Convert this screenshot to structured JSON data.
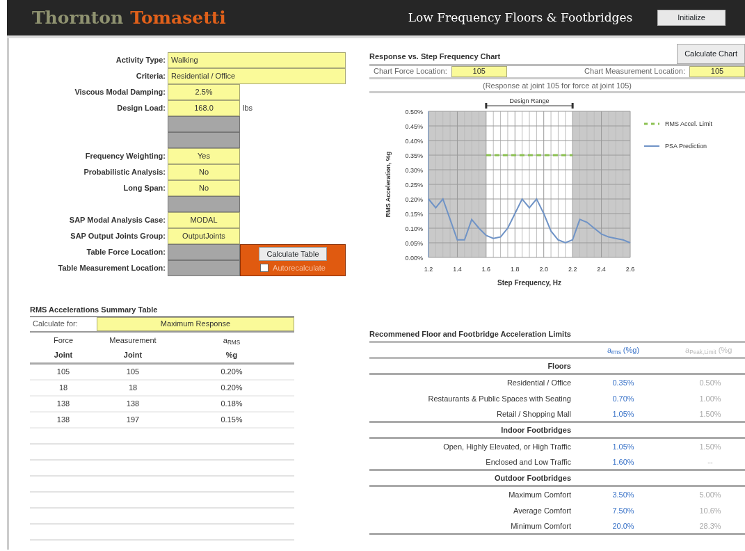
{
  "header": {
    "logo_first": "Thornton",
    "logo_second": "Tomasetti",
    "title": "Low Frequency Floors & Footbridges",
    "button": "Initialize"
  },
  "form": {
    "rows": [
      {
        "label": "Activity Type:",
        "value": "Walking",
        "kind": "wide"
      },
      {
        "label": "Criteria:",
        "value": "Residential / Office",
        "kind": "wide"
      },
      {
        "label": "Viscous Modal Damping:",
        "value": "2.5%",
        "kind": "input"
      },
      {
        "label": "Design Load:",
        "value": "168.0",
        "kind": "input",
        "unit": "lbs"
      },
      {
        "kind": "disabled"
      },
      {
        "kind": "disabled"
      },
      {
        "label": "Frequency Weighting:",
        "value": "Yes",
        "kind": "input"
      },
      {
        "label": "Probabilistic Analysis:",
        "value": "No",
        "kind": "input"
      },
      {
        "label": "Long Span:",
        "value": "No",
        "kind": "input"
      },
      {
        "kind": "disabled"
      },
      {
        "label": "SAP Modal Analysis Case:",
        "value": "MODAL",
        "kind": "input"
      },
      {
        "label": "SAP Output Joints Group:",
        "value": "OutputJoints",
        "kind": "input"
      },
      {
        "label": "Table Force Location:",
        "kind": "disabled"
      },
      {
        "label": "Table Measurement Location:",
        "kind": "disabled"
      }
    ],
    "action_panel": {
      "button": "Calculate Table",
      "checkbox": {
        "label": "Autorecalculate",
        "checked": false
      }
    }
  },
  "chart_panel": {
    "title": "Response vs. Step Frequency Chart",
    "button": "Calculate Chart",
    "force_label": "Chart Force Location:",
    "force_value": "105",
    "measurement_label": "Chart Measurement Location:",
    "measurement_value": "105",
    "subtitle": "(Response at joint 105 for force at joint 105)",
    "chart_data": {
      "type": "line",
      "xlabel": "Step Frequency, Hz",
      "ylabel": "RMS Acceleration, %g",
      "x": [
        1.2,
        1.25,
        1.3,
        1.35,
        1.4,
        1.45,
        1.5,
        1.55,
        1.6,
        1.65,
        1.7,
        1.75,
        1.8,
        1.85,
        1.9,
        1.95,
        2.0,
        2.05,
        2.1,
        2.15,
        2.2,
        2.25,
        2.3,
        2.35,
        2.4,
        2.45,
        2.5,
        2.55,
        2.6
      ],
      "series": [
        {
          "name": "RMS Accel. Limit",
          "color": "#8cc152",
          "line_style": "dashed",
          "values": [
            null,
            null,
            null,
            null,
            null,
            null,
            null,
            null,
            0.35,
            0.35,
            0.35,
            0.35,
            0.35,
            0.35,
            0.35,
            0.35,
            0.35,
            0.35,
            0.35,
            0.35,
            0.35,
            null,
            null,
            null,
            null,
            null,
            null,
            null,
            null
          ]
        },
        {
          "name": "PSA Prediction",
          "color": "#6f93c6",
          "line_style": "solid",
          "values": [
            0.2,
            0.17,
            0.2,
            0.13,
            0.06,
            0.06,
            0.13,
            0.1,
            0.075,
            0.065,
            0.07,
            0.1,
            0.15,
            0.2,
            0.17,
            0.2,
            0.15,
            0.09,
            0.06,
            0.05,
            0.06,
            0.13,
            0.12,
            0.1,
            0.08,
            0.07,
            0.065,
            0.06,
            0.05
          ]
        }
      ],
      "xlim": [
        1.2,
        2.6
      ],
      "ylim": [
        0,
        0.5
      ],
      "xticks": [
        {
          "value": 1.2,
          "label": "1.2"
        },
        {
          "value": 1.4,
          "label": "1.4"
        },
        {
          "value": 1.6,
          "label": "1.6"
        },
        {
          "value": 1.8,
          "label": "1.8"
        },
        {
          "value": 2.0,
          "label": "2.0"
        },
        {
          "value": 2.2,
          "label": "2.2"
        },
        {
          "value": 2.4,
          "label": "2.4"
        },
        {
          "value": 2.6,
          "label": "2.6"
        }
      ],
      "yticks": [
        {
          "value": 0,
          "label": "0.00%"
        },
        {
          "value": 0.05,
          "label": "0.05%"
        },
        {
          "value": 0.1,
          "label": "0.10%"
        },
        {
          "value": 0.15,
          "label": "0.15%"
        },
        {
          "value": 0.2,
          "label": "0.20%"
        },
        {
          "value": 0.25,
          "label": "0.25%"
        },
        {
          "value": 0.3,
          "label": "0.30%"
        },
        {
          "value": 0.35,
          "label": "0.35%"
        },
        {
          "value": 0.4,
          "label": "0.40%"
        },
        {
          "value": 0.45,
          "label": "0.45%"
        },
        {
          "value": 0.5,
          "label": "0.50%"
        }
      ],
      "grid": true,
      "legend": true,
      "bands": [
        {
          "axis": "x",
          "from": 1.2,
          "to": 1.6,
          "color": "#c9c9c9"
        },
        {
          "axis": "x",
          "from": 2.2,
          "to": 2.6,
          "color": "#c9c9c9"
        }
      ],
      "annotations": [
        "Design Range"
      ]
    }
  },
  "summary": {
    "title": "RMS Accelerations Summary Table",
    "calculate_label": "Calculate for:",
    "calculate_value": "Maximum Response",
    "columns": [
      {
        "top": "Force",
        "bottom": "Joint"
      },
      {
        "top": "Measurement",
        "bottom": "Joint"
      },
      {
        "top": "a$_{RMS}$",
        "bottom": "%g"
      }
    ],
    "rows": [
      {
        "force_joint": "105",
        "measurement_joint": "105",
        "a_rms": "0.20%"
      },
      {
        "force_joint": "18",
        "measurement_joint": "18",
        "a_rms": "0.20%"
      },
      {
        "force_joint": "138",
        "measurement_joint": "138",
        "a_rms": "0.18%"
      },
      {
        "force_joint": "138",
        "measurement_joint": "197",
        "a_rms": "0.15%"
      }
    ]
  },
  "limits": {
    "title": "Recommened Floor and Footbridge Acceleration Limits",
    "columns": [
      "a$_{rms}$ (%g)",
      "a$_{Peak,Limit}$ (%g"
    ],
    "groups": [
      {
        "name": "Floors",
        "rows": [
          {
            "label": "Residential / Office",
            "rms": "0.35%",
            "peak": "0.50%"
          },
          {
            "label": "Restaurants & Public Spaces with Seating",
            "rms": "0.70%",
            "peak": "1.00%"
          },
          {
            "label": "Retail / Shopping Mall",
            "rms": "1.05%",
            "peak": "1.50%"
          }
        ]
      },
      {
        "name": "Indoor Footbridges",
        "rows": [
          {
            "label": "Open, Highly Elevated, or High Traffic",
            "rms": "1.05%",
            "peak": "1.50%"
          },
          {
            "label": "Enclosed and Low Traffic",
            "rms": "1.60%",
            "peak": "--"
          }
        ]
      },
      {
        "name": "Outdoor Footbridges",
        "rows": [
          {
            "label": "Maximum Comfort",
            "rms": "3.50%",
            "peak": "5.00%"
          },
          {
            "label": "Average Comfort",
            "rms": "7.50%",
            "peak": "10.6%"
          },
          {
            "label": "Minimum Comfort",
            "rms": "20.0%",
            "peak": "28.3%"
          }
        ]
      }
    ]
  }
}
